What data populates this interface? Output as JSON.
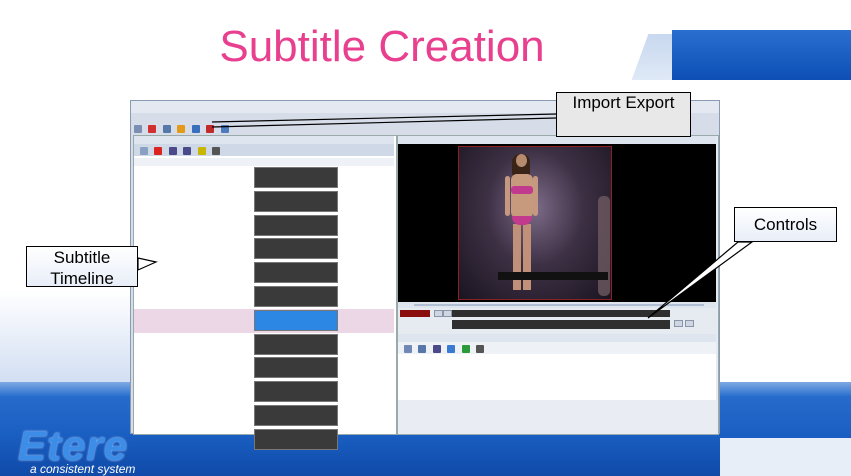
{
  "slide": {
    "title": "Subtitle Creation",
    "logo": "Etere",
    "slogan": "a consistent system"
  },
  "callouts": {
    "timeline": "Subtitle Timeline",
    "import_export": "Import Export",
    "controls": "Controls"
  },
  "colors": {
    "title": "#e8408f",
    "band": "#1a5fc2",
    "selected_row": "#2b86e4"
  }
}
